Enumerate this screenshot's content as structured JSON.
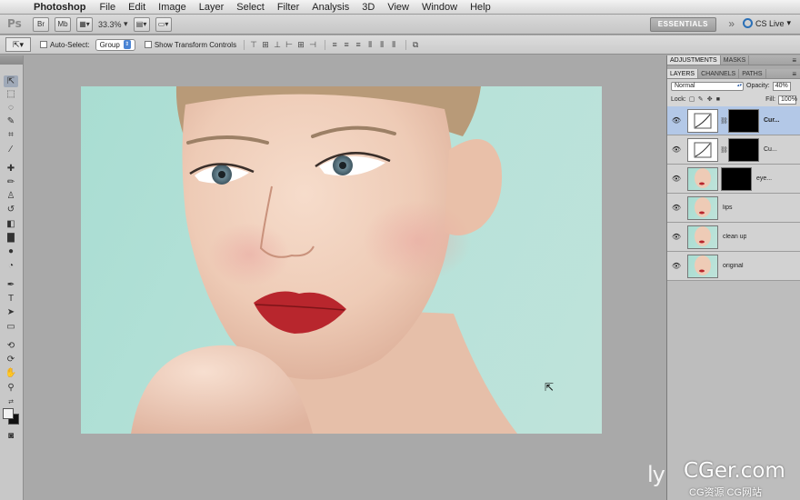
{
  "menubar": {
    "apple_icon": "apple-icon",
    "app_name": "Photoshop",
    "items": [
      "File",
      "Edit",
      "Image",
      "Layer",
      "Select",
      "Filter",
      "Analysis",
      "3D",
      "View",
      "Window",
      "Help"
    ]
  },
  "appbar": {
    "logo": "Ps",
    "zoom": "33.3%",
    "workspace": "ESSENTIALS",
    "cs_live": "CS Live"
  },
  "optionsbar": {
    "auto_select_label": "Auto-Select:",
    "auto_select_value": "Group",
    "show_transform_label": "Show Transform Controls"
  },
  "panels": {
    "top_tabs": [
      "ADJUSTMENTS",
      "MASKS"
    ],
    "layer_tabs": [
      "LAYERS",
      "CHANNELS",
      "PATHS"
    ],
    "blend_mode": "Normal",
    "opacity_label": "Opacity:",
    "opacity": "40%",
    "lock_label": "Lock:",
    "fill_label": "Fill:",
    "fill": "100%",
    "layers": [
      {
        "name": "Cur...",
        "type": "adjustment",
        "has_mask": true,
        "selected": true
      },
      {
        "name": "Cu...",
        "type": "adjustment",
        "has_mask": true,
        "selected": false
      },
      {
        "name": "eye...",
        "type": "photo",
        "has_mask": true,
        "selected": false
      },
      {
        "name": "lips",
        "type": "photo",
        "has_mask": false,
        "selected": false
      },
      {
        "name": "clean up",
        "type": "photo",
        "has_mask": false,
        "selected": false
      },
      {
        "name": "original",
        "type": "photo",
        "has_mask": false,
        "selected": false
      }
    ]
  },
  "watermark": {
    "brand": "ly",
    "main": "CGer.com",
    "sub": "CG资源 CG网站"
  },
  "colors": {
    "background_teal": "#b6e2d9",
    "lip_red": "#b8262d",
    "selection_blue": "#b3c8e7"
  }
}
